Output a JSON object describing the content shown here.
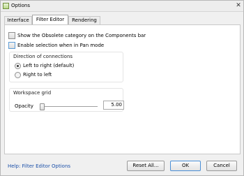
{
  "window": {
    "title": "Options",
    "close_glyph": "✕"
  },
  "tabs": [
    {
      "label": "Interface",
      "active": false
    },
    {
      "label": "Filter Editor",
      "active": true
    },
    {
      "label": "Rendering",
      "active": false
    }
  ],
  "checkboxes": {
    "obsolete": {
      "label": "Show the Obsolete category on the Components bar",
      "checked": false
    },
    "pan_selection": {
      "label": "Enable selection when in Pan mode",
      "checked": false
    }
  },
  "direction": {
    "title": "Direction of connections",
    "options": [
      {
        "label": "Left to right (default)",
        "selected": true
      },
      {
        "label": "Right to left",
        "selected": false
      }
    ]
  },
  "workspace_grid": {
    "title": "Workspace grid",
    "opacity_label": "Opacity",
    "opacity_value": "5.00"
  },
  "footer": {
    "help_link": "Help: Filter Editor Options",
    "reset_label": "Reset All...",
    "ok_label": "OK",
    "cancel_label": "Cancel"
  },
  "icons": {
    "app": "app-icon",
    "close": "close-icon"
  }
}
